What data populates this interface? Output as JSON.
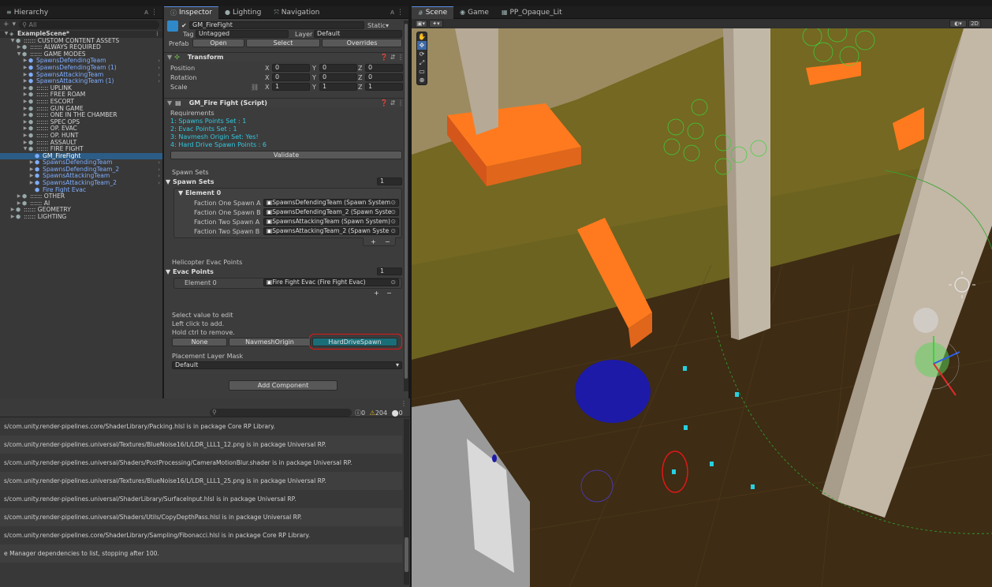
{
  "hierarchy": {
    "tab_label": "Hierarchy",
    "search_placeholder": "All",
    "add_label": "+",
    "rows": [
      {
        "label": "ExampleScene*",
        "indent": 0,
        "arrow": "▼",
        "style": "scene"
      },
      {
        "label": ":::::: CUSTOM CONTENT ASSETS",
        "indent": 1,
        "arrow": "▼",
        "style": ""
      },
      {
        "label": ":::::: ALWAYS REQUIRED",
        "indent": 2,
        "arrow": "▶",
        "style": ""
      },
      {
        "label": ":::::: GAME MODES",
        "indent": 2,
        "arrow": "▼",
        "style": ""
      },
      {
        "label": "SpawnsDefendingTeam",
        "indent": 3,
        "arrow": "▶",
        "style": "blue"
      },
      {
        "label": "SpawnsDefendingTeam (1)",
        "indent": 3,
        "arrow": "▶",
        "style": "blue"
      },
      {
        "label": "SpawnsAttackingTeam",
        "indent": 3,
        "arrow": "▶",
        "style": "blue"
      },
      {
        "label": "SpawnsAttackingTeam (1)",
        "indent": 3,
        "arrow": "▶",
        "style": "blue"
      },
      {
        "label": ":::::: UPLINK",
        "indent": 3,
        "arrow": "▶",
        "style": ""
      },
      {
        "label": ":::::: FREE ROAM",
        "indent": 3,
        "arrow": "▶",
        "style": ""
      },
      {
        "label": ":::::: ESCORT",
        "indent": 3,
        "arrow": "▶",
        "style": ""
      },
      {
        "label": ":::::: GUN GAME",
        "indent": 3,
        "arrow": "▶",
        "style": ""
      },
      {
        "label": ":::::: ONE IN THE CHAMBER",
        "indent": 3,
        "arrow": "▶",
        "style": ""
      },
      {
        "label": ":::::: SPEC OPS",
        "indent": 3,
        "arrow": "▶",
        "style": ""
      },
      {
        "label": ":::::: OP. EVAC",
        "indent": 3,
        "arrow": "▶",
        "style": ""
      },
      {
        "label": ":::::: OP. HUNT",
        "indent": 3,
        "arrow": "▶",
        "style": ""
      },
      {
        "label": ":::::: ASSAULT",
        "indent": 3,
        "arrow": "▶",
        "style": ""
      },
      {
        "label": ":::::: FIRE FIGHT",
        "indent": 3,
        "arrow": "▼",
        "style": ""
      },
      {
        "label": "GM_FireFight",
        "indent": 4,
        "arrow": "",
        "style": "selected"
      },
      {
        "label": "SpawnsDefendingTeam",
        "indent": 4,
        "arrow": "▶",
        "style": "blue"
      },
      {
        "label": "SpawnsDefendingTeam_2",
        "indent": 4,
        "arrow": "▶",
        "style": "blue"
      },
      {
        "label": "SpawnsAttackingTeam",
        "indent": 4,
        "arrow": "▶",
        "style": "blue"
      },
      {
        "label": "SpawnsAttackingTeam_2",
        "indent": 4,
        "arrow": "▶",
        "style": "blue"
      },
      {
        "label": "Fire Fight Evac",
        "indent": 4,
        "arrow": "",
        "style": "blue"
      },
      {
        "label": ":::::: OTHER",
        "indent": 2,
        "arrow": "▶",
        "style": ""
      },
      {
        "label": ":::::: AI",
        "indent": 2,
        "arrow": "▶",
        "style": ""
      },
      {
        "label": ":::::: GEOMETRY",
        "indent": 1,
        "arrow": "▶",
        "style": ""
      },
      {
        "label": ":::::: LIGHTING",
        "indent": 1,
        "arrow": "▶",
        "style": ""
      }
    ]
  },
  "inspector": {
    "tabs": [
      "Inspector",
      "Lighting",
      "Navigation"
    ],
    "object_name": "GM_FireFight",
    "static_label": "Static",
    "tag_label": "Tag",
    "tag_value": "Untagged",
    "layer_label": "Layer",
    "layer_value": "Default",
    "prefab_label": "Prefab",
    "prefab_open": "Open",
    "prefab_select": "Select",
    "prefab_overrides": "Overrides",
    "transform": {
      "title": "Transform",
      "position_label": "Position",
      "rotation_label": "Rotation",
      "scale_label": "Scale",
      "position": [
        "0",
        "0",
        "0"
      ],
      "rotation": [
        "0",
        "0",
        "0"
      ],
      "scale": [
        "1",
        "1",
        "1"
      ],
      "axis_x": "X",
      "axis_y": "Y",
      "axis_z": "Z"
    },
    "script": {
      "title": "GM_Fire Fight (Script)",
      "requirements_label": "Requirements",
      "requirements": [
        "1: Spawns Points Set : 1",
        "2: Evac Points Set : 1",
        "3: Navmesh Origin Set: Yes!",
        "4: Hard Drive Spawn Points : 6"
      ],
      "validate_label": "Validate",
      "spawn_sets_header": "Spawn Sets",
      "spawn_sets_label": "Spawn Sets",
      "spawn_sets_count": "1",
      "element0_label": "Element 0",
      "faction_rows": [
        {
          "label": "Faction One Spawn A",
          "value": "SpawnsDefendingTeam (Spawn System"
        },
        {
          "label": "Faction One Spawn B",
          "value": "SpawnsDefendingTeam_2 (Spawn Syste"
        },
        {
          "label": "Faction Two Spawn A",
          "value": "SpawnsAttackingTeam (Spawn System)"
        },
        {
          "label": "Faction Two Spawn B",
          "value": "SpawnsAttackingTeam_2 (Spawn Syste"
        }
      ],
      "heli_header": "Helicopter Evac Points",
      "evac_points_label": "Evac Points",
      "evac_count": "1",
      "evac_element_label": "Element 0",
      "evac_element_value": "Fire Fight Evac (Fire Fight Evac)",
      "plus": "+",
      "minus": "−",
      "help_lines": [
        "Select value to edit",
        "Left click to add.",
        "Hold ctrl to remove."
      ],
      "mode_buttons": [
        "None",
        "NavmeshOrigin",
        "HardDriveSpawn"
      ],
      "placement_label": "Placement Layer Mask",
      "placement_value": "Default"
    },
    "add_component": "Add Component"
  },
  "console": {
    "search_placeholder": "",
    "count_info": "0",
    "count_warn": "204",
    "count_err": "0",
    "lines": [
      "s/com.unity.render-pipelines.core/ShaderLibrary/Packing.hlsl is in package Core RP Library.",
      "s/com.unity.render-pipelines.universal/Textures/BlueNoise16/L/LDR_LLL1_12.png is in package Universal RP.",
      "s/com.unity.render-pipelines.universal/Shaders/PostProcessing/CameraMotionBlur.shader is in package Universal RP.",
      "s/com.unity.render-pipelines.universal/Textures/BlueNoise16/L/LDR_LLL1_25.png is in package Universal RP.",
      "s/com.unity.render-pipelines.universal/ShaderLibrary/SurfaceInput.hlsl is in package Universal RP.",
      "s/com.unity.render-pipelines.universal/Shaders/Utils/CopyDepthPass.hlsl is in package Universal RP.",
      "s/com.unity.render-pipelines.core/ShaderLibrary/Sampling/Fibonacci.hlsl is in package Core RP Library.",
      "e Manager dependencies to list, stopping after 100."
    ]
  },
  "scene": {
    "tabs": [
      "Scene",
      "Game",
      "PP_Opaque_Lit"
    ],
    "mode_2d": "2D"
  },
  "colors": {
    "accent": "#2c5d87",
    "hard_drive_button": "#1b6e78",
    "annotation": "#e01818",
    "ground": "#4a3518",
    "orange": "#ff7a1e"
  }
}
